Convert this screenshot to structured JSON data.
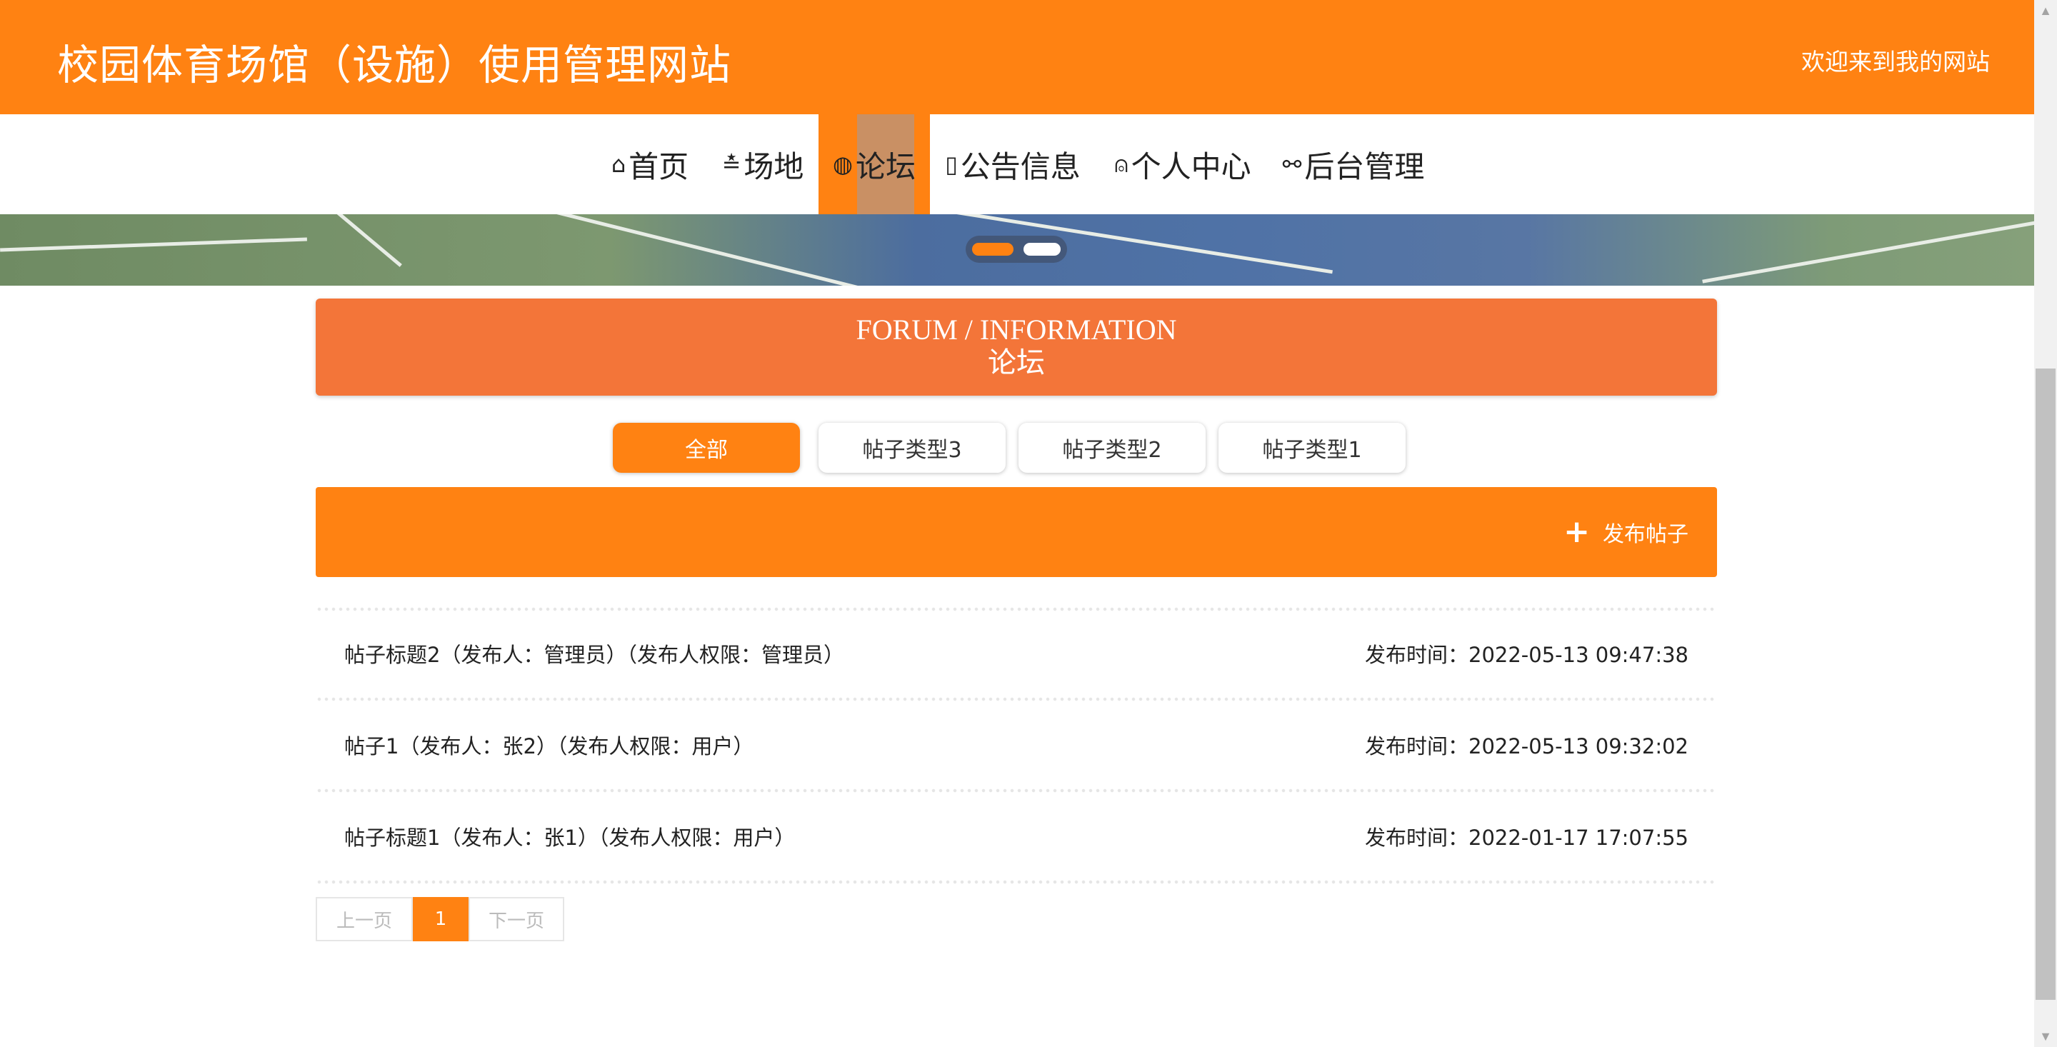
{
  "header": {
    "title": "校园体育场馆（设施）使用管理网站",
    "welcome": "欢迎来到我的网站"
  },
  "nav": {
    "items": [
      {
        "label": "首页",
        "icon": "home-icon",
        "glyph": "⌂"
      },
      {
        "label": "场地",
        "icon": "sliders-icon",
        "glyph": "≛"
      },
      {
        "label": "论坛",
        "icon": "palette-icon",
        "glyph": "◍",
        "active": true
      },
      {
        "label": "公告信息",
        "icon": "note-icon",
        "glyph": "▯"
      },
      {
        "label": "个人中心",
        "icon": "user-icon",
        "glyph": "⍝"
      },
      {
        "label": "后台管理",
        "icon": "link-icon",
        "glyph": "⚯"
      }
    ]
  },
  "banner": {
    "slides": 2,
    "active_slide": 1
  },
  "forum": {
    "title_en": "FORUM / INFORMATION",
    "title_zh": "论坛"
  },
  "tabs": [
    {
      "label": "全部",
      "active": true
    },
    {
      "label": "帖子类型3"
    },
    {
      "label": "帖子类型2"
    },
    {
      "label": "帖子类型1"
    }
  ],
  "actions": {
    "post_label": "发布帖子",
    "post_icon": "plus-icon"
  },
  "posts": [
    {
      "title": "帖子标题2（发布人：管理员）（发布人权限：管理员）",
      "time": "发布时间：2022-05-13 09:47:38"
    },
    {
      "title": "帖子1（发布人：张2）（发布人权限：用户）",
      "time": "发布时间：2022-05-13 09:32:02"
    },
    {
      "title": "帖子标题1（发布人：张1）（发布人权限：用户）",
      "time": "发布时间：2022-01-17 17:07:55"
    }
  ],
  "pagination": {
    "prev": "上一页",
    "current": "1",
    "next": "下一页"
  },
  "colors": {
    "primary": "#ff8212",
    "forum_header": "#f37539",
    "active_nav_highlight": "#c99064"
  }
}
